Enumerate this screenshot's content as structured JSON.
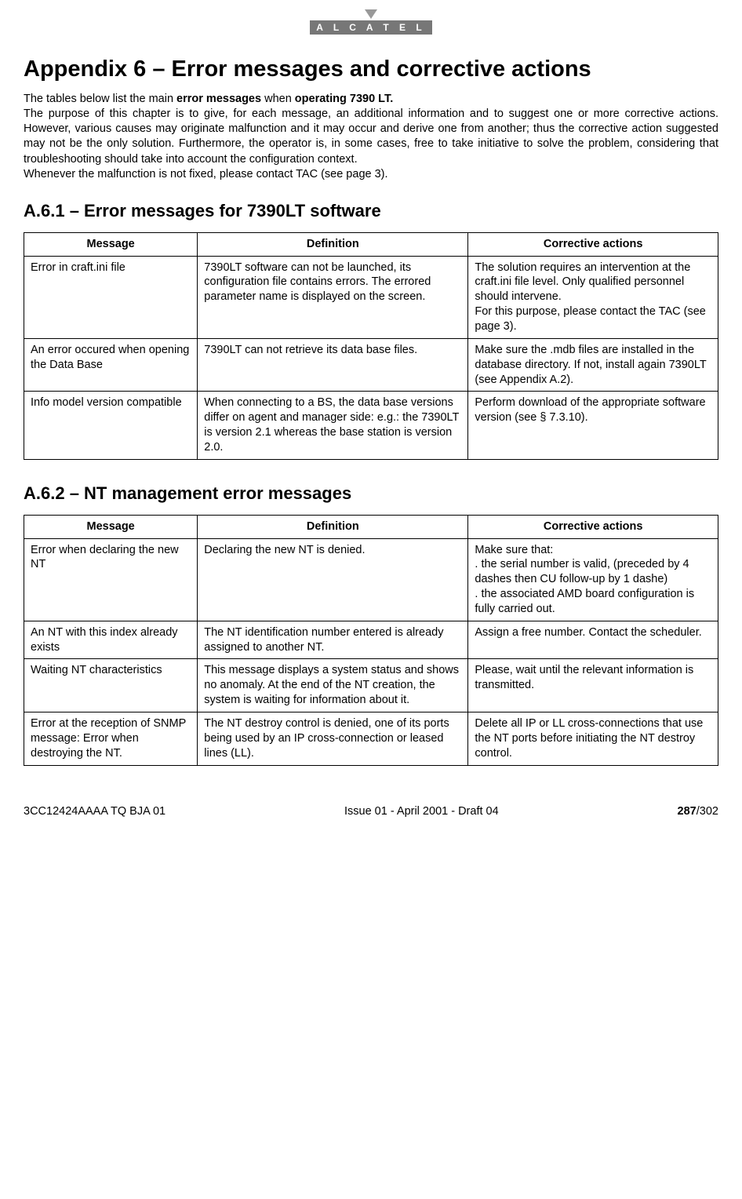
{
  "logo": {
    "text": "A L C A T E L"
  },
  "title": "Appendix 6 – Error messages and corrective actions",
  "intro": {
    "line1_pre": "The tables below list the main ",
    "line1_b1": "error messages",
    "line1_mid": " when ",
    "line1_b2": "operating 7390 LT.",
    "para2": "The purpose of this chapter is to give, for each message, an additional information and to suggest one or more corrective actions. However, various causes may originate malfunction and it may occur and derive one from another; thus the corrective action suggested may not be the only solution. Furthermore, the operator is, in some cases, free to take initiative to solve the problem, considering that troubleshooting should take into account the configuration context.",
    "para3": "Whenever the malfunction is not fixed, please contact TAC (see page 3)."
  },
  "section1": {
    "heading": "A.6.1 – Error messages for 7390LT software",
    "headers": {
      "msg": "Message",
      "def": "Definition",
      "act": "Corrective actions"
    },
    "rows": [
      {
        "msg": "Error in craft.ini file",
        "def": "7390LT software can not be launched, its configuration file contains errors. The errored parameter name is displayed on the screen.",
        "act": "The solution requires an intervention at the craft.ini file level. Only qualified personnel should intervene.\nFor this purpose, please contact the TAC (see page 3)."
      },
      {
        "msg": "An error occured when opening the Data Base",
        "def": "7390LT can not retrieve its data base files.",
        "act": "Make sure the .mdb files are installed in the database directory. If not, install again 7390LT (see Appendix A.2)."
      },
      {
        "msg": "Info model version compatible",
        "def": "When connecting to a BS, the data base versions differ on agent and manager side: e.g.: the 7390LT is version 2.1 whereas the base station is version 2.0.",
        "act": "Perform download of the appropriate software version (see § 7.3.10)."
      }
    ]
  },
  "section2": {
    "heading": "A.6.2 – NT management error messages",
    "headers": {
      "msg": "Message",
      "def": "Definition",
      "act": "Corrective actions"
    },
    "rows": [
      {
        "msg": "Error when declaring the new NT",
        "def": "Declaring the new NT is denied.",
        "act": "Make sure that:\n.  the serial number is valid, (preceded by 4 dashes then CU follow-up by 1 dashe)\n.  the associated AMD board configuration is fully carried out."
      },
      {
        "msg": "An NT with this index already exists",
        "def": "The NT identification number entered is already assigned to another NT.",
        "act": "Assign a free number. Contact the scheduler."
      },
      {
        "msg": "Waiting NT characteristics",
        "def": "This message displays a system status and shows no anomaly. At the end of the NT creation, the system is waiting for information about it.",
        "act": "Please, wait until the relevant information is transmitted."
      },
      {
        "msg": "Error at the reception of SNMP message: Error when destroying the NT.",
        "def": "The NT destroy control is denied, one of its ports being used by an IP cross-connection or leased lines (LL).",
        "act": "Delete all IP or LL cross-connections that use the NT ports before initiating the NT destroy control."
      }
    ]
  },
  "footer": {
    "left": "3CC12424AAAA TQ BJA 01",
    "center": "Issue 01 - April 2001 - Draft 04",
    "page_current": "287",
    "page_sep_total": "/302"
  }
}
